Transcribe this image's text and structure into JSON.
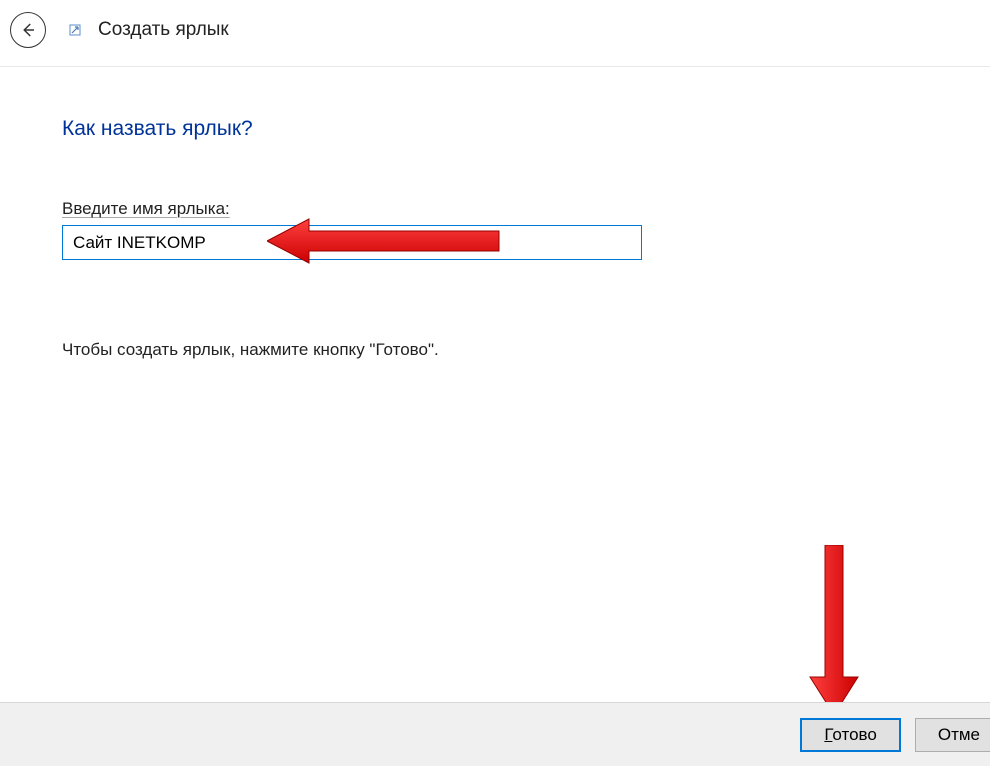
{
  "header": {
    "title": "Создать ярлык"
  },
  "main": {
    "heading": "Как назвать ярлык?",
    "input_label": "Введите имя ярлыка:",
    "input_value": "Сайт INETKOMP",
    "help_text": "Чтобы создать ярлык, нажмите кнопку \"Готово\"."
  },
  "footer": {
    "finish_label_u": "Г",
    "finish_label_rest": "отово",
    "cancel_label": "Отме"
  }
}
